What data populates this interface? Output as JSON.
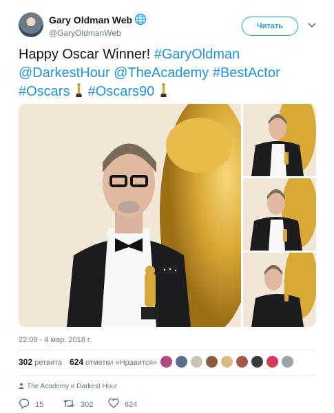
{
  "author": {
    "name": "Gary Oldman Web",
    "handle": "@GaryOldmanWeb",
    "follow_label": "Читать"
  },
  "tweet": {
    "line1_text": "Happy Oscar Winner! ",
    "line1_tag": "#GaryOldman",
    "line2_m1": "@DarkestHour",
    "line2_m2": "@TheAcademy",
    "line2_tag": "#BestActor",
    "line3_tag1": "#Oscars",
    "line3_tag2": "#Oscars90",
    "timestamp": "22:09 - 4 мар. 2018 г."
  },
  "stats": {
    "retweets_count": "302",
    "retweets_label": "ретвита",
    "likes_count": "624",
    "likes_label": "отметки «Нравится»"
  },
  "context": {
    "text": "The Academy и Darkest Hour"
  },
  "actions": {
    "replies": "15",
    "retweets": "302",
    "likes": "624"
  },
  "colors": {
    "link": "#1b95e0",
    "accent": "#1da1f2",
    "muted": "#657786",
    "gold": "#d4a43a"
  },
  "icons": [
    "verified-globe-icon",
    "chevron-down-icon",
    "oscar-statuette-icon",
    "reply-icon",
    "retweet-icon",
    "heart-icon"
  ]
}
